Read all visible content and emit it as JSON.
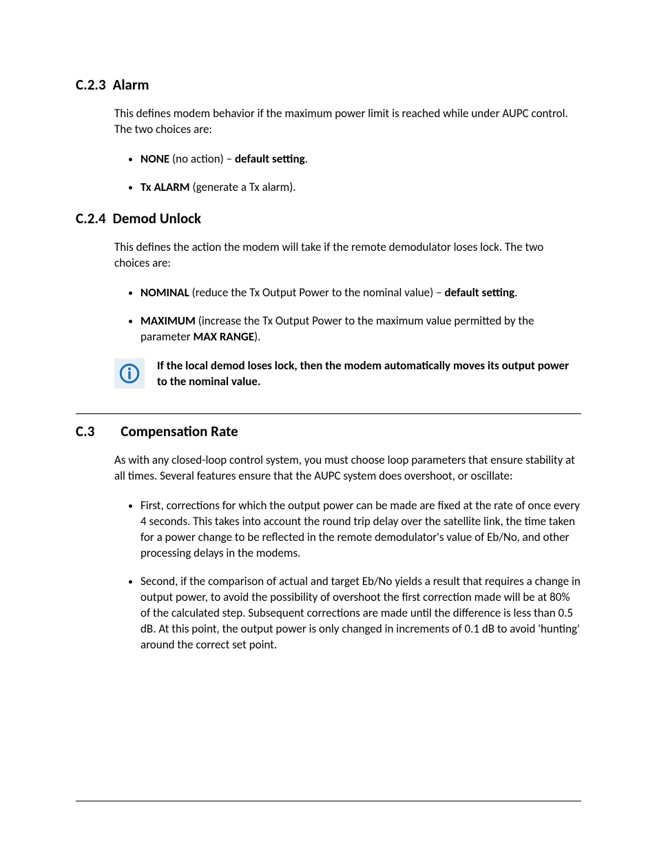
{
  "sections": {
    "c23": {
      "num": "C.2.3",
      "title": "Alarm",
      "intro": "This defines modem behavior if the maximum power limit is reached while under AUPC control. The two choices are:",
      "bullets": {
        "b1": {
          "strong1": "NONE",
          "mid": " (no action) – ",
          "strong2": "default setting",
          "tail": "."
        },
        "b2": {
          "strong1": "Tx ALARM",
          "tail": " (generate a Tx alarm)."
        }
      }
    },
    "c24": {
      "num": "C.2.4",
      "title": "Demod Unlock",
      "intro": "This defines the action the modem will take if the remote demodulator loses lock. The two choices are:",
      "bullets": {
        "b1": {
          "strong1": "NOMINAL",
          "mid": " (reduce the Tx Output Power to the nominal value) – ",
          "strong2": "default setting",
          "tail": "."
        },
        "b2": {
          "strong1": "MAXIMUM",
          "mid": " (increase the Tx Output Power to the maximum value permitted by the parameter ",
          "strong2": "MAX RANGE",
          "tail": ")."
        }
      },
      "note": "If the local demod loses lock, then the modem automatically moves its output power to the nominal value."
    },
    "c3": {
      "num": "C.3",
      "title": "Compensation Rate",
      "intro": "As with any closed-loop control system, you must choose loop parameters that ensure stability at all times. Several features ensure that the AUPC system does overshoot, or oscillate:",
      "bullets": {
        "b1": "First, corrections for which the output power can be made are fixed at the rate of once every 4 seconds. This takes into account the round trip delay over the satellite link, the time taken for a power change to be reflected in the remote demodulator's value of Eb/No, and other processing delays in the modems.",
        "b2": "Second, if the comparison of actual and target Eb/No yields a result that requires a change in output power, to avoid the possibility of overshoot the first correction made will be at 80% of the calculated step. Subsequent corrections are made until the difference is less than 0.5 dB. At this point, the output power is only changed in increments of 0.1 dB to avoid 'hunting' around the correct set point."
      }
    }
  }
}
